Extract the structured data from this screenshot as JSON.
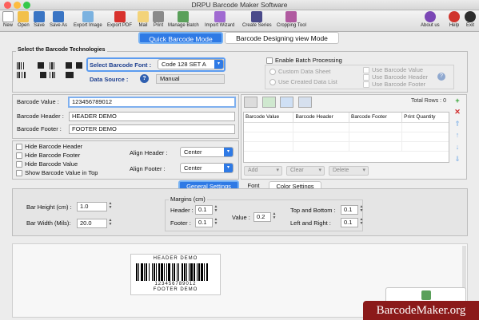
{
  "app": {
    "title": "DRPU Barcode Maker Software"
  },
  "toolbar": {
    "new": "New",
    "open": "Open",
    "save": "Save",
    "save_as": "Save As",
    "export_image": "Export Image",
    "export_pdf": "Export PDF",
    "mail": "Mail",
    "print": "Print",
    "manage_batch": "Manage Batch",
    "import_wizard": "Import Wizard",
    "create_series": "Create Series",
    "cropping_tool": "Cropping Tool",
    "about_us": "About us",
    "help": "Help",
    "exit": "Exit"
  },
  "modes": {
    "quick": "Quick Barcode Mode",
    "designing": "Barcode Designing view Mode"
  },
  "technologies": {
    "legend": "Select the Barcode Technologies",
    "font_label": "Select Barcode Font :",
    "font_value": "Code 128 SET A",
    "data_source_label": "Data Source :",
    "data_source_value": "Manual",
    "batch_label": "Enable Batch Processing",
    "custom_sheet": "Custom Data Sheet",
    "created_list": "Use Created Data List",
    "use_value": "Use Barcode Value",
    "use_header": "Use Barcode Header",
    "use_footer": "Use Barcode Footer"
  },
  "fields": {
    "value_label": "Barcode Value :",
    "value": "123456789012",
    "header_label": "Barcode Header :",
    "header": "HEADER DEMO",
    "footer_label": "Barcode Footer :",
    "footer": "FOOTER DEMO"
  },
  "options": {
    "hide_header": "Hide Barcode Header",
    "hide_footer": "Hide Barcode Footer",
    "hide_value": "Hide Barcode Value",
    "show_top": "Show Barcode Value in Top",
    "align_header_label": "Align Header :",
    "align_header": "Center",
    "align_footer_label": "Align Footer :",
    "align_footer": "Center"
  },
  "grid": {
    "total_rows": "Total Rows : 0",
    "columns": [
      "Barcode Value",
      "Barcode Header",
      "Barcode Footer",
      "Print Quantity"
    ],
    "add": "Add",
    "clear": "Clear",
    "delete": "Delete"
  },
  "tabs": {
    "general": "General Settings",
    "font": "Font Settings",
    "color": "Color Settings"
  },
  "general": {
    "bar_height_label": "Bar Height (cm) :",
    "bar_height": "1.0",
    "bar_width_label": "Bar Width (Mils):",
    "bar_width": "20.0",
    "margins_legend": "Margins (cm)",
    "header_label": "Header :",
    "header": "0.1",
    "footer_label": "Footer :",
    "footer": "0.1",
    "value_label": "Value :",
    "value": "0.2",
    "top_bottom_label": "Top and Bottom :",
    "top_bottom": "0.1",
    "left_right_label": "Left and Right :",
    "left_right": "0.1"
  },
  "preview": {
    "header": "HEADER DEMO",
    "value": "123456789012",
    "footer": "FOOTER DEMO"
  },
  "watermark": "BarcodeMaker.org",
  "colors": {
    "accent": "#2f7ae5",
    "watermark_bg": "#8b1a1a"
  }
}
